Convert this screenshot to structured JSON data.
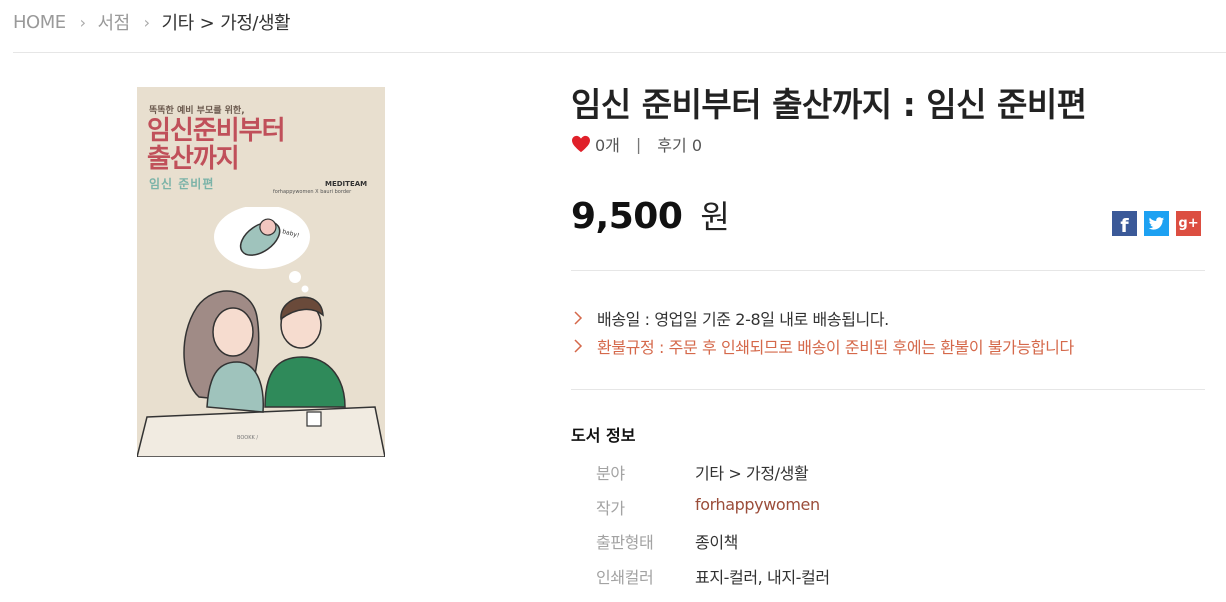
{
  "breadcrumb": {
    "home": "HOME",
    "store": "서점",
    "category": "기타",
    "subcategory": "가정/생활"
  },
  "cover": {
    "tagline": "똑똑한 예비 부모를 위한,",
    "title_line1": "임신준비부터",
    "title_line2": "출산까지",
    "subtitle": "임신 준비편",
    "publisher": "MEDITEAM",
    "publisher_sub": "forhappywomen X bauri border"
  },
  "product": {
    "title": "임신 준비부터 출산까지 : 임신 준비편",
    "likes": "0개",
    "reviews": "후기 0",
    "price": "9,500",
    "price_unit": "원"
  },
  "share": {
    "facebook": "f",
    "twitter": "t",
    "google": "g+"
  },
  "notices": {
    "shipping": "배송일 : 영업일 기준 2-8일 내로 배송됩니다.",
    "refund": "환불규정 : 주문 후 인쇄되므로 배송이 준비된 후에는 환불이 불가능합니다"
  },
  "book_info": {
    "heading": "도서 정보",
    "rows": [
      {
        "label": "분야",
        "value": "기타 > 가정/생활"
      },
      {
        "label": "작가",
        "value": "forhappywomen"
      },
      {
        "label": "출판형태",
        "value": "종이책"
      },
      {
        "label": "인쇄컬러",
        "value": "표지-컬러, 내지-컬러"
      }
    ]
  },
  "colors": {
    "refund_text": "#d5694b",
    "author_text": "#9b4d3a",
    "heart": "#e0202a",
    "cover_bg": "#e8dfcf",
    "cover_title": "#c0505a"
  }
}
